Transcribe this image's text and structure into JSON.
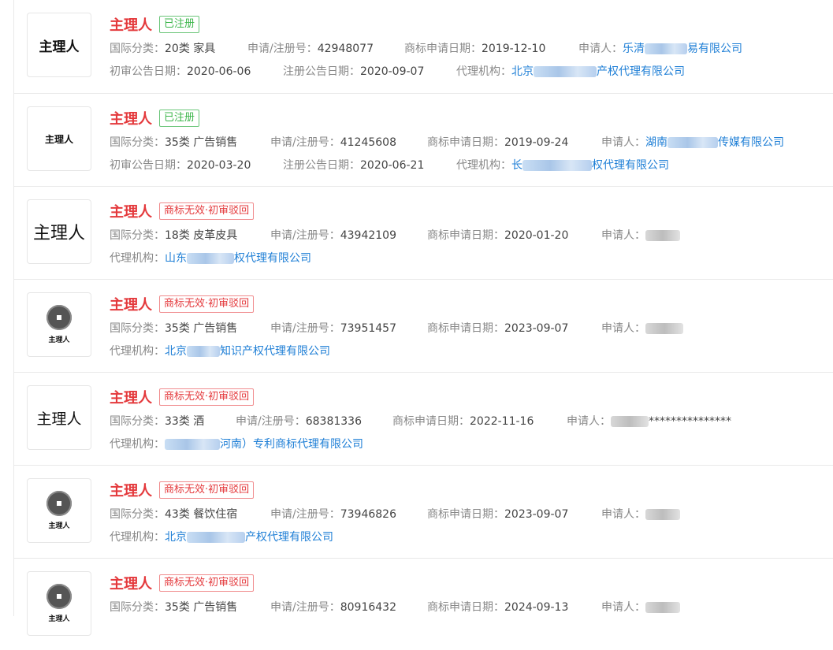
{
  "labels": {
    "category": "国际分类：",
    "reg_no": "申请/注册号：",
    "apply_date": "商标申请日期：",
    "applicant": "申请人：",
    "prelim_date": "初审公告日期：",
    "reg_date": "注册公告日期：",
    "agency": "代理机构："
  },
  "colors": {
    "name_red": "#e4393c",
    "link_blue": "#1f7fd6",
    "ok_green": "#3bb54a"
  },
  "items": [
    {
      "name": "主理人",
      "status": "已注册",
      "status_type": "ok",
      "category": "20类 家具",
      "reg_no": "42948077",
      "apply_date": "2019-12-10",
      "applicant_a": "乐清",
      "applicant_b": "易有限公司",
      "prelim_date": "2020-06-06",
      "reg_date": "2020-09-07",
      "agency_a": "北京",
      "agency_b": "产权代理有限公司",
      "mark_text": "主理人"
    },
    {
      "name": "主理人",
      "status": "已注册",
      "status_type": "ok",
      "category": "35类 广告销售",
      "reg_no": "41245608",
      "apply_date": "2019-09-24",
      "applicant_a": "湖南",
      "applicant_b": "传媒有限公司",
      "prelim_date": "2020-03-20",
      "reg_date": "2020-06-21",
      "agency_a": "长",
      "agency_b": "权代理有限公司",
      "mark_text": "主理人"
    },
    {
      "name": "主理人",
      "status": "商标无效·初审驳回",
      "status_type": "bad",
      "category": "18类 皮革皮具",
      "reg_no": "43942109",
      "apply_date": "2020-01-20",
      "agency_a": "山东",
      "agency_b": "权代理有限公司",
      "mark_text": "主理人"
    },
    {
      "name": "主理人",
      "status": "商标无效·初审驳回",
      "status_type": "bad",
      "category": "35类 广告销售",
      "reg_no": "73951457",
      "apply_date": "2023-09-07",
      "agency_a": "北京",
      "agency_b": "知识产权代理有限公司",
      "mark_text": "主理人"
    },
    {
      "name": "主理人",
      "status": "商标无效·初审驳回",
      "status_type": "bad",
      "category": "33类 酒",
      "reg_no": "68381336",
      "apply_date": "2022-11-16",
      "applicant_b": "***************",
      "agency_a": "",
      "agency_b": "河南）专利商标代理有限公司",
      "mark_text": "主理人"
    },
    {
      "name": "主理人",
      "status": "商标无效·初审驳回",
      "status_type": "bad",
      "category": "43类 餐饮住宿",
      "reg_no": "73946826",
      "apply_date": "2023-09-07",
      "agency_a": "北京",
      "agency_b": "产权代理有限公司",
      "mark_text": "主理人"
    },
    {
      "name": "主理人",
      "status": "商标无效·初审驳回",
      "status_type": "bad",
      "category": "35类 广告销售",
      "reg_no": "80916432",
      "apply_date": "2024-09-13",
      "mark_text": "主理人"
    }
  ]
}
